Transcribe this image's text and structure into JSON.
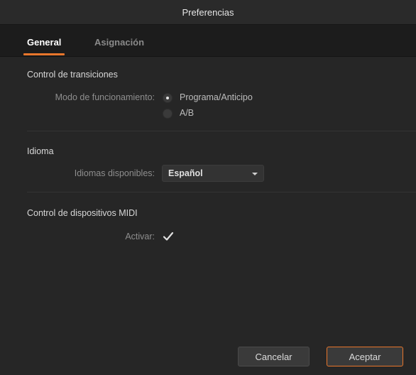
{
  "window": {
    "title": "Preferencias"
  },
  "tabs": [
    {
      "label": "General",
      "active": true
    },
    {
      "label": "Asignación",
      "active": false
    }
  ],
  "transitions": {
    "section_title": "Control de transiciones",
    "mode_label": "Modo de funcionamiento:",
    "options": [
      {
        "label": "Programa/Anticipo",
        "selected": true
      },
      {
        "label": "A/B",
        "selected": false
      }
    ]
  },
  "language": {
    "section_title": "Idioma",
    "field_label": "Idiomas disponibles:",
    "selected": "Español"
  },
  "midi": {
    "section_title": "Control de dispositivos MIDI",
    "enable_label": "Activar:",
    "enabled": true
  },
  "buttons": {
    "cancel": "Cancelar",
    "ok": "Aceptar"
  },
  "colors": {
    "accent": "#e8762c",
    "background": "#262626"
  }
}
